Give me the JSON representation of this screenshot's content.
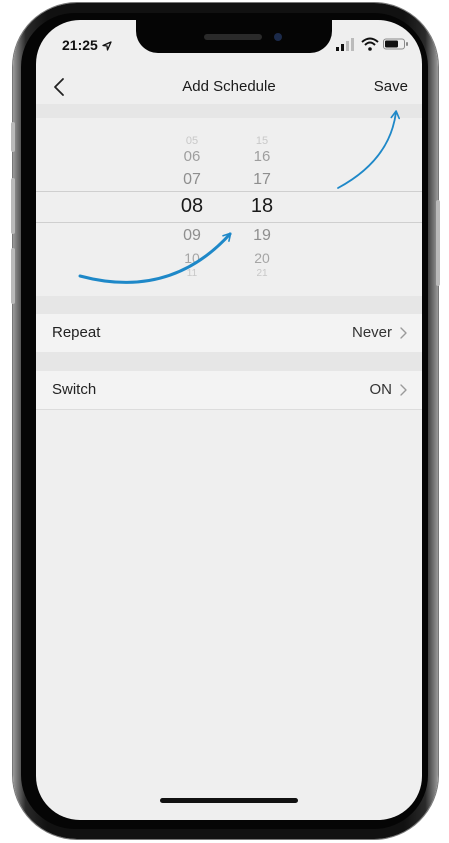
{
  "status_bar": {
    "time": "21:25"
  },
  "nav": {
    "title": "Add Schedule",
    "save_label": "Save"
  },
  "picker": {
    "hours": [
      "05",
      "06",
      "07",
      "08",
      "09",
      "10",
      "11"
    ],
    "minutes": [
      "15",
      "16",
      "17",
      "18",
      "19",
      "20",
      "21"
    ],
    "selected_hour": "08",
    "selected_minute": "18"
  },
  "settings": [
    {
      "label": "Repeat",
      "value": "Never"
    },
    {
      "label": "Switch",
      "value": "ON"
    }
  ],
  "colors": {
    "annotation_arrow": "#1e88c8",
    "background": "#efefef"
  }
}
